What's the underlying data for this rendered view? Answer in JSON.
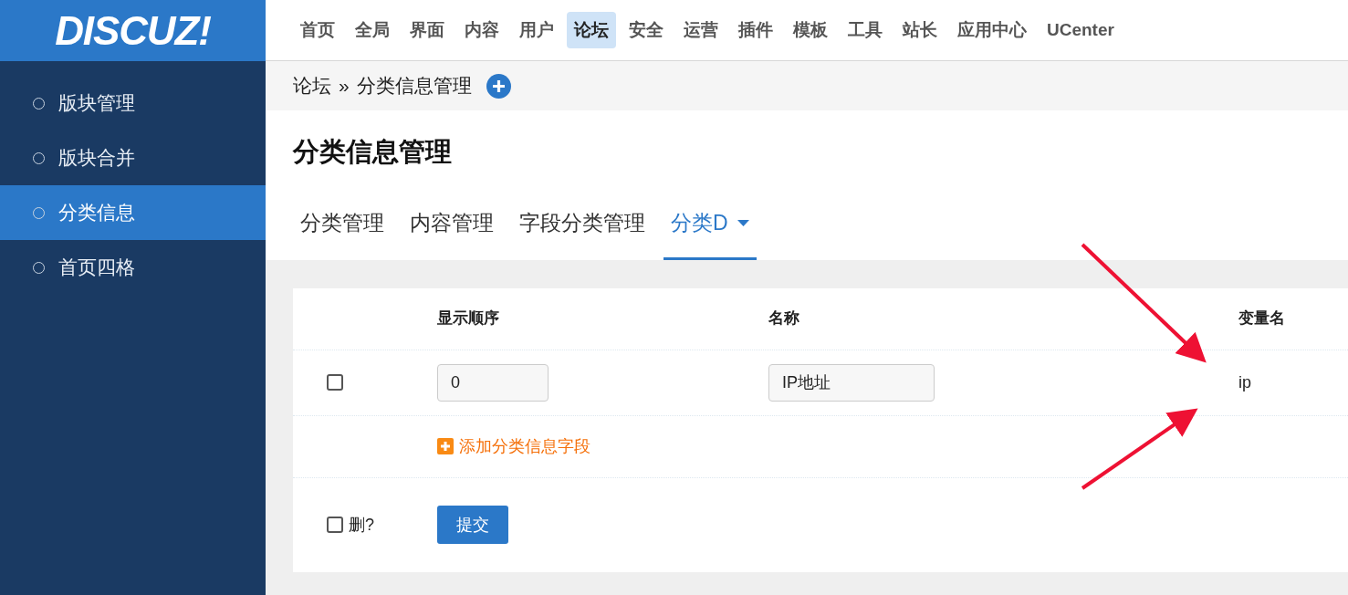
{
  "logo": {
    "text": "DISCUZ!"
  },
  "top_nav": [
    {
      "label": "首页",
      "selected": false
    },
    {
      "label": "全局",
      "selected": false
    },
    {
      "label": "界面",
      "selected": false
    },
    {
      "label": "内容",
      "selected": false
    },
    {
      "label": "用户",
      "selected": false
    },
    {
      "label": "论坛",
      "selected": true
    },
    {
      "label": "安全",
      "selected": false
    },
    {
      "label": "运营",
      "selected": false
    },
    {
      "label": "插件",
      "selected": false
    },
    {
      "label": "模板",
      "selected": false
    },
    {
      "label": "工具",
      "selected": false
    },
    {
      "label": "站长",
      "selected": false
    },
    {
      "label": "应用中心",
      "selected": false
    },
    {
      "label": "UCenter",
      "selected": false
    }
  ],
  "sidebar": {
    "items": [
      {
        "label": "版块管理",
        "selected": false
      },
      {
        "label": "版块合并",
        "selected": false
      },
      {
        "label": "分类信息",
        "selected": true
      },
      {
        "label": "首页四格",
        "selected": false
      }
    ]
  },
  "breadcrumb": {
    "parent": "论坛",
    "separator": "»",
    "current": "分类信息管理"
  },
  "page_title": "分类信息管理",
  "tabs": [
    {
      "label": "分类管理",
      "selected": false,
      "dropdown": false
    },
    {
      "label": "内容管理",
      "selected": false,
      "dropdown": false
    },
    {
      "label": "字段分类管理",
      "selected": false,
      "dropdown": false
    },
    {
      "label": "分类D",
      "selected": true,
      "dropdown": true
    }
  ],
  "table": {
    "columns": [
      "显示顺序",
      "名称",
      "变量名"
    ],
    "rows": [
      {
        "checked": false,
        "order": "0",
        "name": "IP地址",
        "variable": "ip"
      }
    ],
    "add_link": "添加分类信息字段",
    "delete_label": "删?",
    "delete_checked": false,
    "submit": "提交"
  }
}
